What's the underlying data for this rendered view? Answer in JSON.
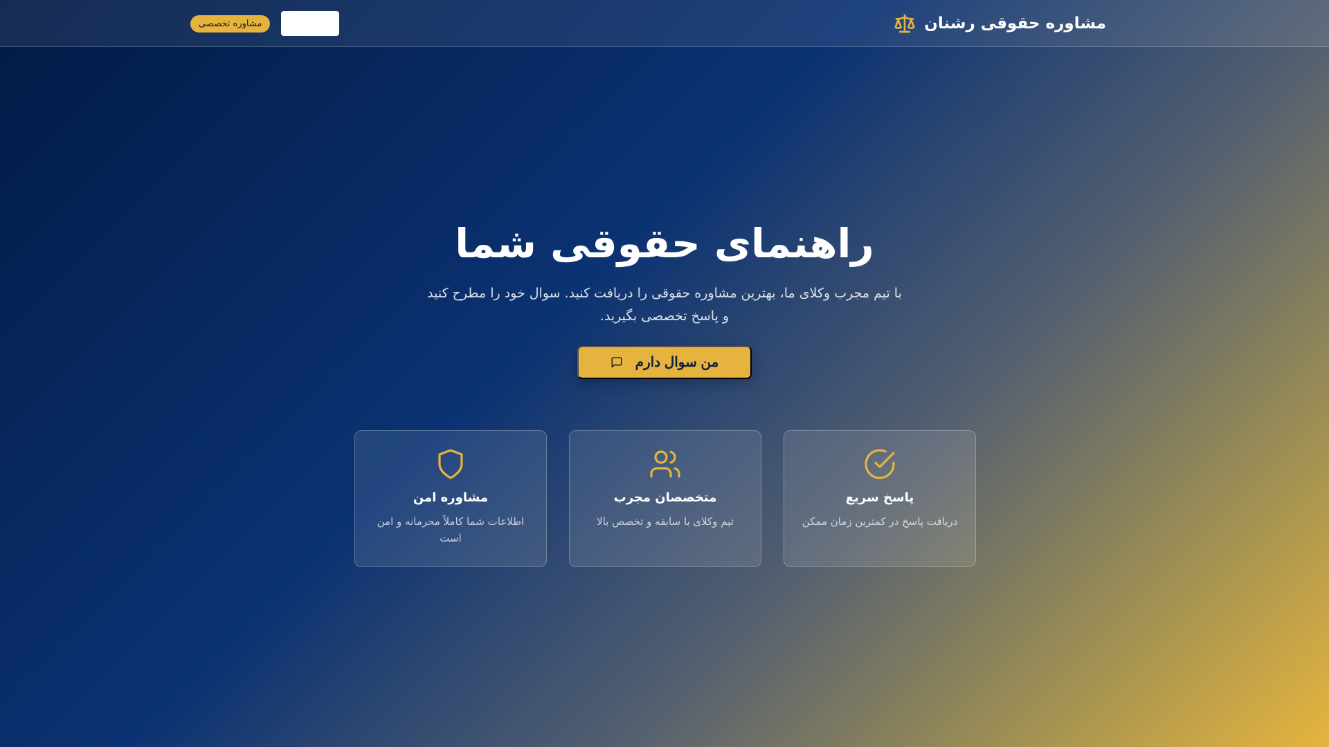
{
  "header": {
    "brand_title": "مشاوره حقوقی رشنان",
    "brand_icon": "scale-icon",
    "badge_label": "مشاوره تخصصی"
  },
  "hero": {
    "title": "راهنمای حقوقی شما",
    "subtitle": "با تیم مجرب وکلای ما، بهترین مشاوره حقوقی را دریافت کنید. سوال خود را مطرح کنید و پاسخ تخصصی بگیرید.",
    "cta_label": "من سوال دارم",
    "cta_icon": "message-icon"
  },
  "features": [
    {
      "icon": "shield-icon",
      "title": "مشاوره امن",
      "description": "اطلاعات شما کاملاً محرمانه و امن است"
    },
    {
      "icon": "users-icon",
      "title": "متخصصان مجرب",
      "description": "تیم وکلای با سابقه و تخصص بالا"
    },
    {
      "icon": "check-circle-icon",
      "title": "پاسخ سریع",
      "description": "دریافت پاسخ در کمترین زمان ممکن"
    }
  ],
  "colors": {
    "accent": "#e6b43e",
    "navy": "#0b3272",
    "dark_navy": "#021a45"
  }
}
